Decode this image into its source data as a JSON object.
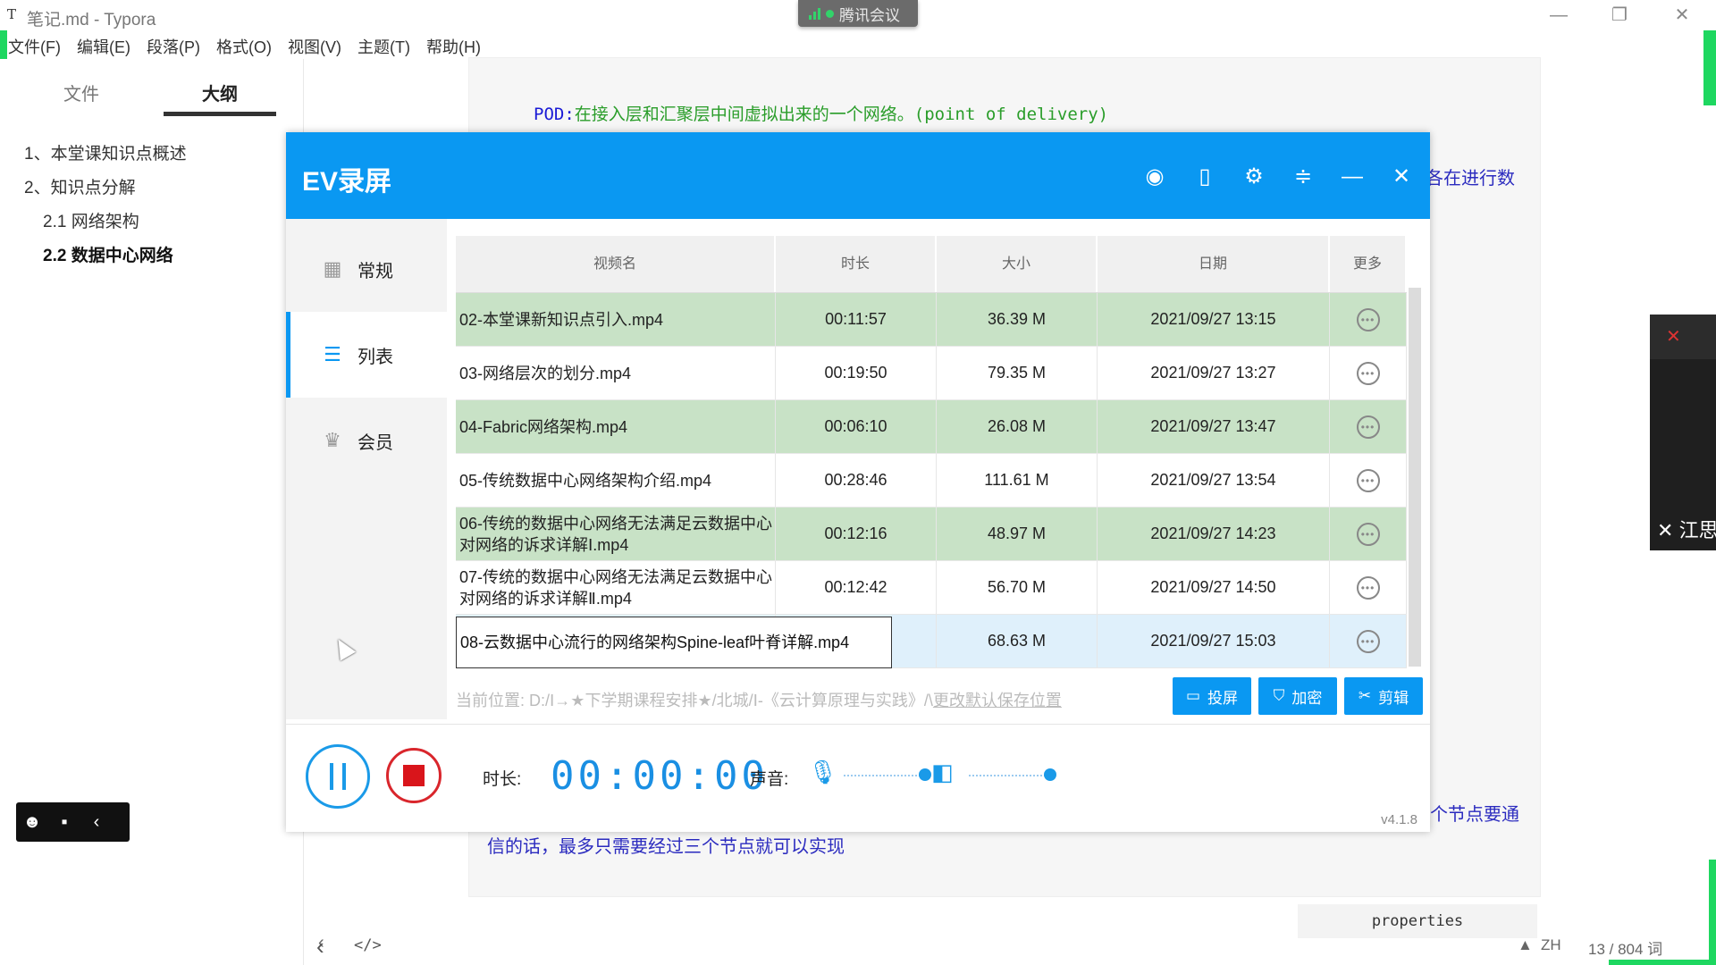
{
  "typora": {
    "app_icon": "T",
    "title": "笔记.md - Typora",
    "window_controls": [
      "—",
      "❐",
      "✕"
    ],
    "menu": [
      "文件(F)",
      "编辑(E)",
      "段落(P)",
      "格式(O)",
      "视图(V)",
      "主题(T)",
      "帮助(H)"
    ],
    "sidebar_tabs": [
      "文件",
      "大纲"
    ],
    "outline": [
      {
        "label": "1、本堂课知识点概述",
        "level": 1
      },
      {
        "label": "2、知识点分解",
        "level": 1
      },
      {
        "label": "2.1 网络架构",
        "level": 2
      },
      {
        "label": "2.2 数据中心网络",
        "level": 2
      }
    ],
    "doc": {
      "pod_keyword": "POD:",
      "pod_text": "在接入层和汇聚层中间虚拟出来的一个网络。",
      "pod_paren": "(point of delivery)",
      "fragment_right_1": "各在进行数",
      "fragment_right_2": "个节点要通",
      "last_line": "信的话，最多只需要经过三个节点就可以实现"
    },
    "properties_label": "properties",
    "status_lang": "ZH",
    "status_count": "13 / 804 词"
  },
  "meeting": {
    "label": "腾讯会议"
  },
  "video_thumb": {
    "name": "江思"
  },
  "ev": {
    "title": "EV录屏",
    "nav": [
      {
        "label": "常规",
        "icon": "grid-icon"
      },
      {
        "label": "列表",
        "icon": "list-icon"
      },
      {
        "label": "会员",
        "icon": "crown-icon"
      }
    ],
    "columns": [
      "视频名",
      "时长",
      "大小",
      "日期",
      "更多"
    ],
    "rows": [
      {
        "name": "02-本堂课新知识点引入.mp4",
        "duration": "00:11:57",
        "size": "36.39 M",
        "date": "2021/09/27 13:15"
      },
      {
        "name": "03-网络层次的划分.mp4",
        "duration": "00:19:50",
        "size": "79.35 M",
        "date": "2021/09/27 13:27"
      },
      {
        "name": "04-Fabric网络架构.mp4",
        "duration": "00:06:10",
        "size": "26.08 M",
        "date": "2021/09/27 13:47"
      },
      {
        "name": "05-传统数据中心网络架构介绍.mp4",
        "duration": "00:28:46",
        "size": "111.61 M",
        "date": "2021/09/27 13:54"
      },
      {
        "name": "06-传统的数据中心网络无法满足云数据中心对网络的诉求详解Ⅰ.mp4",
        "duration": "00:12:16",
        "size": "48.97 M",
        "date": "2021/09/27 14:23"
      },
      {
        "name": "07-传统的数据中心网络无法满足云数据中心对网络的诉求详解Ⅱ.mp4",
        "duration": "00:12:42",
        "size": "56.70 M",
        "date": "2021/09/27 14:50"
      },
      {
        "name": "08-云数据中心流行的网络架构Spine-leaf叶脊详解.mp4",
        "duration": "",
        "size": "68.63 M",
        "date": "2021/09/27 15:03"
      }
    ],
    "path_prefix": "当前位置: D:/Ⅰ→★下学期课程安排★/北城/Ⅰ-《云计算原理与实践》/\\",
    "path_link": "更改默认保存位置",
    "buttons": [
      "投屏",
      "加密",
      "剪辑"
    ],
    "duration_label": "时长:",
    "timer": "00:00:00",
    "sound_label": "声音:",
    "version": "v4.1.8",
    "accent": "#0a98f2"
  }
}
